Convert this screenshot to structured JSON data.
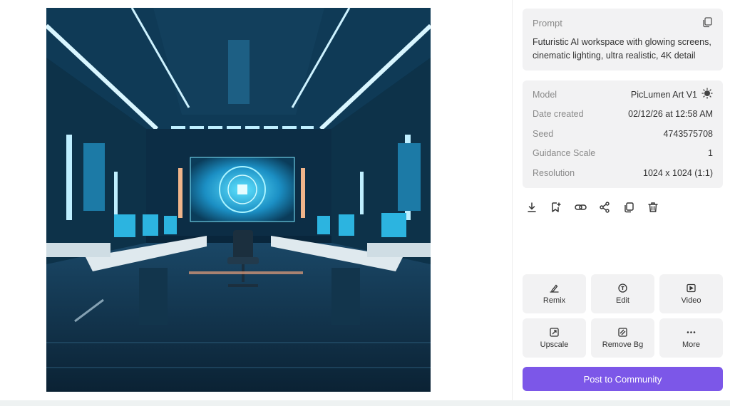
{
  "image": {
    "alt": "Futuristic AI workspace with glowing screens, cinematic lighting, ultra realistic, 4K detail"
  },
  "prompt": {
    "title": "Prompt",
    "text": "Futuristic AI workspace with glowing screens, cinematic lighting, ultra realistic, 4K detail",
    "copy_icon": "copy-icon"
  },
  "meta": [
    {
      "label": "Model",
      "value": "PicLumen Art V1"
    },
    {
      "label": "Date created",
      "value": "02/12/26 at 12:58 AM"
    },
    {
      "label": "Seed",
      "value": "4743575708"
    },
    {
      "label": "Guidance Scale",
      "value": "1"
    },
    {
      "label": "Resolution",
      "value": "1024 x 1024 (1:1)"
    }
  ],
  "actions": [
    "download-icon",
    "bookmark-add-icon",
    "link-icon",
    "share-icon",
    "copy-icon",
    "trash-icon"
  ],
  "tools": [
    {
      "label": "Remix",
      "icon": "remix-icon"
    },
    {
      "label": "Edit",
      "icon": "edit-icon"
    },
    {
      "label": "Video",
      "icon": "video-icon"
    },
    {
      "label": "Upscale",
      "icon": "upscale-icon"
    },
    {
      "label": "Remove Bg",
      "icon": "remove-bg-icon"
    },
    {
      "label": "More",
      "icon": "more-icon"
    }
  ],
  "post_button": "Post to Community",
  "colors": {
    "accent": "#7c57e8",
    "card_bg": "#f2f2f3",
    "muted_text": "#8a8a8a"
  }
}
